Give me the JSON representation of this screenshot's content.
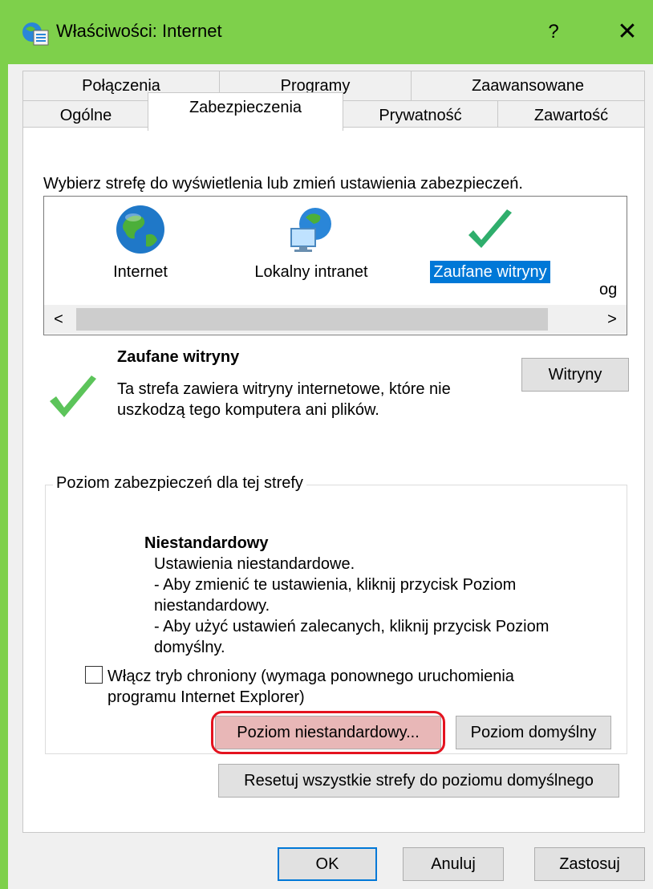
{
  "window": {
    "title": "Właściwości: Internet",
    "help_label": "?",
    "close_label": "✕",
    "accent": "#7ed04b"
  },
  "tabs": {
    "row1": [
      "Połączenia",
      "Programy",
      "Zaawansowane"
    ],
    "row2": [
      "Ogólne",
      "Zabezpieczenia",
      "Prywatność",
      "Zawartość"
    ],
    "active": "Zabezpieczenia"
  },
  "security": {
    "zone_prompt": "Wybierz strefę do wyświetlenia lub zmień ustawienia zabezpieczeń.",
    "zones": [
      {
        "label": "Internet",
        "icon": "globe-icon"
      },
      {
        "label": "Lokalny intranet",
        "icon": "intranet-icon"
      },
      {
        "label": "Zaufane witryny",
        "icon": "checkmark-icon",
        "selected": true
      },
      {
        "label": "og",
        "icon": "restricted-sites-icon"
      }
    ],
    "scroll_left": "<",
    "scroll_right": ">",
    "zone_title": "Zaufane witryny",
    "zone_desc_1": "Ta strefa zawiera witryny internetowe, które nie",
    "zone_desc_2": "uszkodzą tego komputera ani plików.",
    "sites_button": "Witryny"
  },
  "level": {
    "group_title": "Poziom zabezpieczeń dla tej strefy",
    "name": "Niestandardowy",
    "lines": [
      "Ustawienia niestandardowe.",
      "- Aby zmienić te ustawienia, kliknij przycisk Poziom",
      "niestandardowy.",
      "- Aby użyć ustawień zalecanych, kliknij przycisk Poziom",
      "domyślny."
    ],
    "protected_mode_line1": "Włącz tryb chroniony (wymaga ponownego uruchomienia",
    "protected_mode_line2": "programu Internet Explorer)",
    "protected_mode_checked": false,
    "custom_button": "Poziom niestandardowy...",
    "default_button": "Poziom domyślny",
    "reset_all_button": "Resetuj wszystkie strefy do poziomu domyślnego"
  },
  "footer": {
    "ok": "OK",
    "cancel": "Anuluj",
    "apply": "Zastosuj"
  }
}
